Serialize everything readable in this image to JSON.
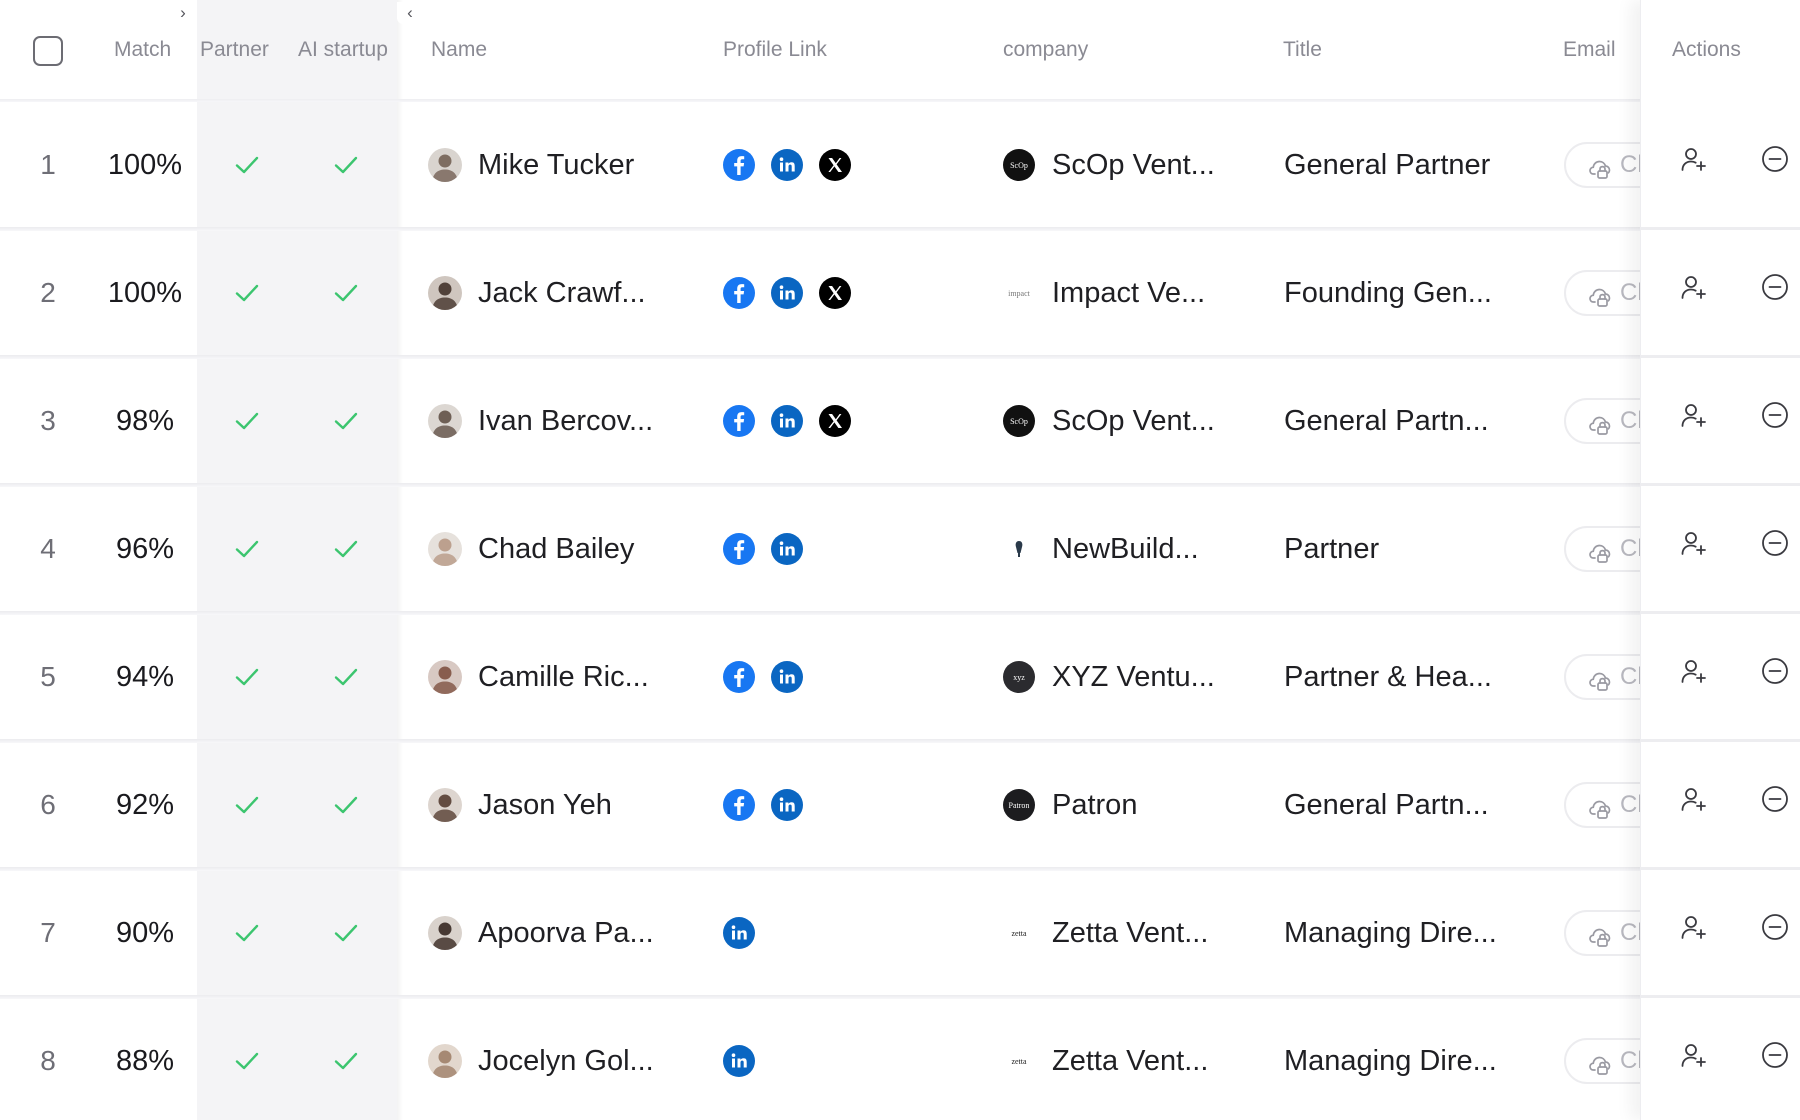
{
  "header": {
    "match": "Match",
    "partner": "Partner",
    "ai_startup": "AI startup",
    "name": "Name",
    "profile_link": "Profile Link",
    "company": "company",
    "title": "Title",
    "email": "Email",
    "actions": "Actions",
    "expand_chevron": "›",
    "collapse_chevron": "‹"
  },
  "colors": {
    "check_green": "#3cc56f",
    "facebook_blue": "#1877f2",
    "linkedin_blue": "#0a66c2",
    "x_black": "#000000"
  },
  "icons": {
    "partner": "check-icon",
    "ai_startup": "check-icon",
    "email": "cloud-lock-icon",
    "add_contact": "user-plus-icon",
    "remove": "minus-circle-icon"
  },
  "rows": [
    {
      "index": "1",
      "match": "100%",
      "name": "Mike Tucker",
      "socials": [
        "facebook",
        "linkedin",
        "x"
      ],
      "company": "ScOp Vent...",
      "logo_text": "ScOp",
      "title": "General Partner",
      "email_text": "Cl",
      "partner": true,
      "ai_startup": true
    },
    {
      "index": "2",
      "match": "100%",
      "name": "Jack Crawf...",
      "socials": [
        "facebook",
        "linkedin",
        "x"
      ],
      "company": "Impact Ve...",
      "logo_text": "impact",
      "title": "Founding Gen...",
      "email_text": "Cl",
      "partner": true,
      "ai_startup": true
    },
    {
      "index": "3",
      "match": "98%",
      "name": "Ivan Bercov...",
      "socials": [
        "facebook",
        "linkedin",
        "x"
      ],
      "company": "ScOp Vent...",
      "logo_text": "ScOp",
      "title": "General Partn...",
      "email_text": "Cl",
      "partner": true,
      "ai_startup": true
    },
    {
      "index": "4",
      "match": "96%",
      "name": "Chad Bailey",
      "socials": [
        "facebook",
        "linkedin"
      ],
      "company": "NewBuild...",
      "logo_text": "",
      "title": "Partner",
      "email_text": "Cl",
      "partner": true,
      "ai_startup": true
    },
    {
      "index": "5",
      "match": "94%",
      "name": "Camille Ric...",
      "socials": [
        "facebook",
        "linkedin"
      ],
      "company": "XYZ Ventu...",
      "logo_text": "xyz",
      "title": "Partner & Hea...",
      "email_text": "Cl",
      "partner": true,
      "ai_startup": true
    },
    {
      "index": "6",
      "match": "92%",
      "name": "Jason Yeh",
      "socials": [
        "facebook",
        "linkedin"
      ],
      "company": "Patron",
      "logo_text": "Patron",
      "title": "General Partn...",
      "email_text": "Cl",
      "partner": true,
      "ai_startup": true
    },
    {
      "index": "7",
      "match": "90%",
      "name": "Apoorva Pa...",
      "socials": [
        "linkedin"
      ],
      "company": "Zetta Vent...",
      "logo_text": "zetta",
      "title": "Managing Dire...",
      "email_text": "Cl",
      "partner": true,
      "ai_startup": true
    },
    {
      "index": "8",
      "match": "88%",
      "name": "Jocelyn Gol...",
      "socials": [
        "linkedin"
      ],
      "company": "Zetta Vent...",
      "logo_text": "zetta",
      "title": "Managing Dire...",
      "email_text": "Cl",
      "partner": true,
      "ai_startup": true
    }
  ]
}
